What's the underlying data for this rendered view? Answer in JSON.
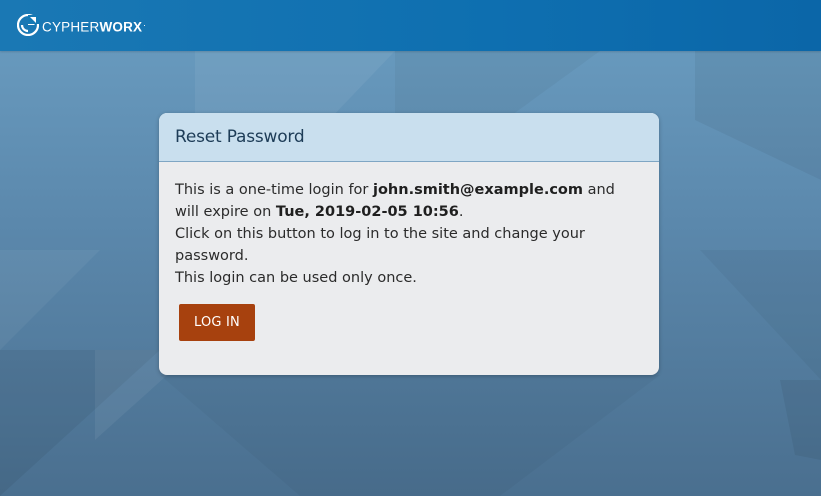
{
  "header": {
    "brand": {
      "part1": "CYPHER",
      "part2": "WORX",
      "suffix": "."
    }
  },
  "card": {
    "title": "Reset Password",
    "line1_prefix": "This is a one-time login for ",
    "email": "john.smith@example.com",
    "line1_mid": " and will expire on ",
    "expiry": "Tue, 2019-02-05 10:56",
    "line1_end": ".",
    "line2": "Click on this button to log in to the site and change your password.",
    "line3": "This login can be used only once.",
    "button_label": "LOG IN"
  },
  "colors": {
    "header_bg": "#0e6fb0",
    "card_header_bg": "#c9dfee",
    "button_bg": "#a7410e"
  }
}
